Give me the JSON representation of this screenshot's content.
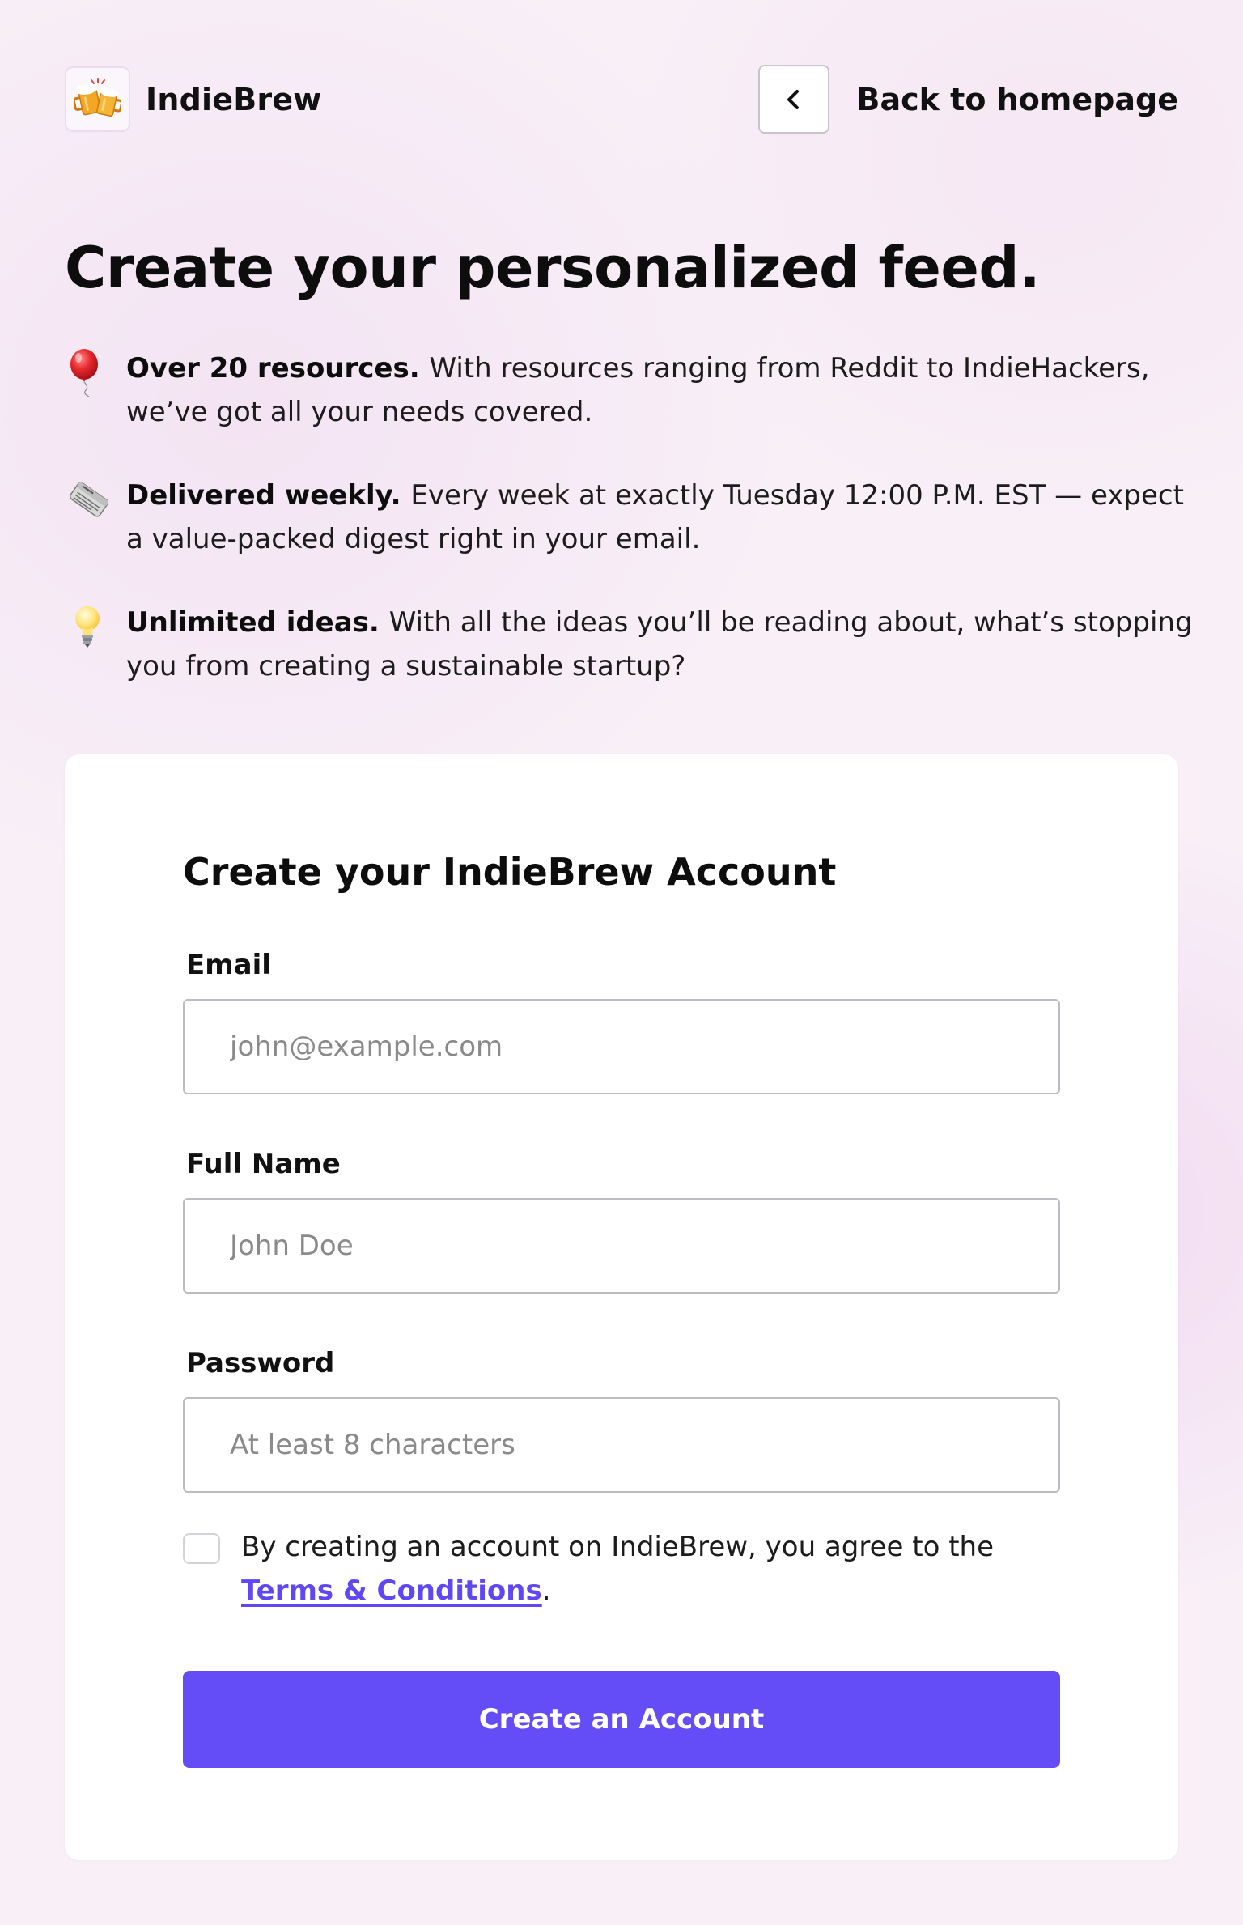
{
  "header": {
    "brand_name": "IndieBrew",
    "logo_icon": "beer-mugs-icon",
    "back_label": "Back to homepage",
    "back_icon": "chevron-left-icon"
  },
  "hero": {
    "headline": "Create your personalized feed."
  },
  "features": [
    {
      "icon": "balloon-icon",
      "title": "Over 20 resources.",
      "text": "With resources ranging from Reddit to IndieHackers, we’ve got all your needs covered."
    },
    {
      "icon": "newspaper-icon",
      "title": "Delivered weekly.",
      "text": "Every week at exactly Tuesday 12:00 P.M. EST — expect a value-packed digest right in your email."
    },
    {
      "icon": "light-bulb-icon",
      "title": "Unlimited ideas.",
      "text": "With all the ideas you’ll be reading about, what’s stopping you from creating a sustainable startup?"
    }
  ],
  "form": {
    "title": "Create your IndieBrew Account",
    "email": {
      "label": "Email",
      "placeholder": "john@example.com",
      "value": ""
    },
    "full_name": {
      "label": "Full Name",
      "placeholder": "John Doe",
      "value": ""
    },
    "password": {
      "label": "Password",
      "placeholder": "At least 8 characters",
      "value": ""
    },
    "agree": {
      "checked": false,
      "text_before": "By creating an account on IndieBrew, you agree to the",
      "link_text": "Terms & Conditions",
      "text_after": "."
    },
    "submit_label": "Create an Account"
  },
  "colors": {
    "accent": "#644cf6",
    "link": "#5f47f3",
    "background": "#f8eff7",
    "card": "#ffffff"
  }
}
